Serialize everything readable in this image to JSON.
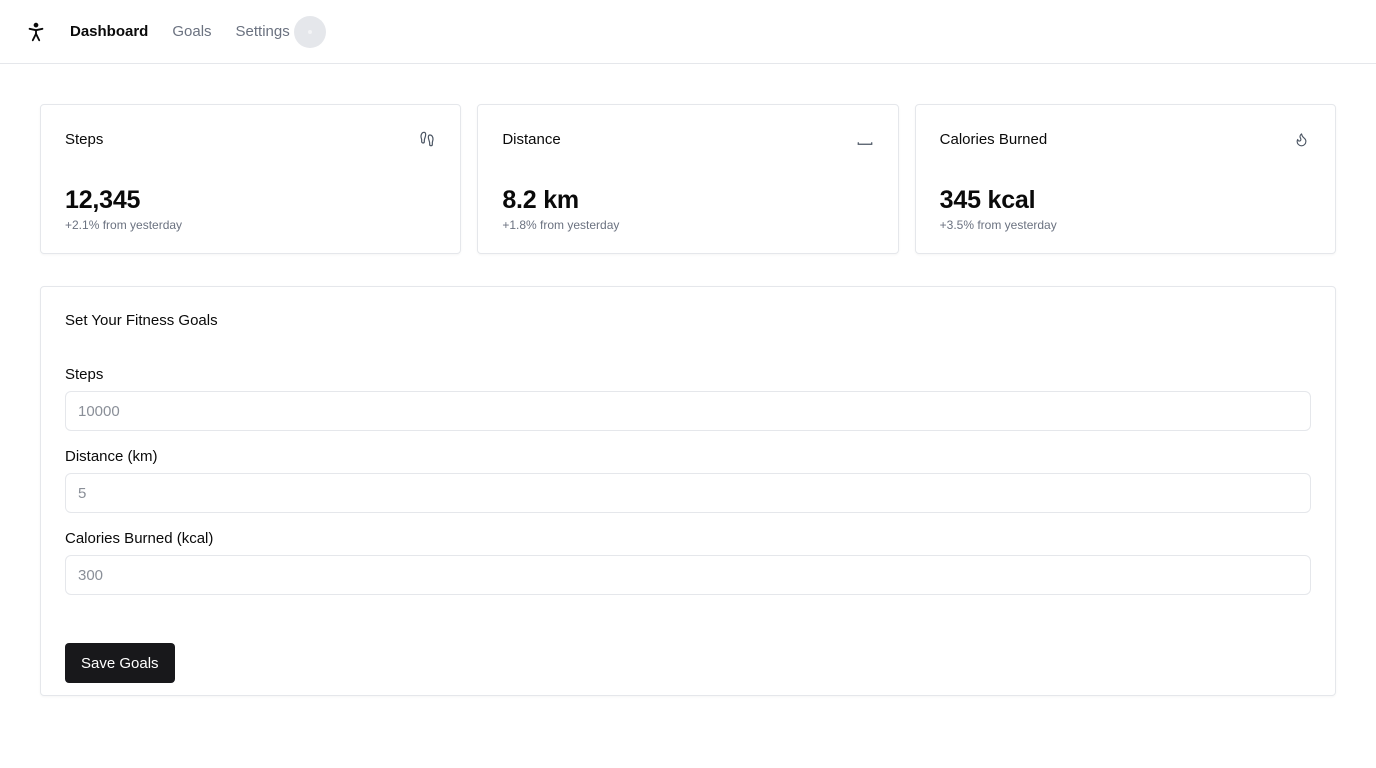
{
  "nav": {
    "logo_icon": "person-standing-icon",
    "items": [
      {
        "label": "Dashboard",
        "active": true
      },
      {
        "label": "Goals",
        "active": false
      },
      {
        "label": "Settings",
        "active": false
      }
    ]
  },
  "stats": [
    {
      "title": "Steps",
      "icon": "footprints-icon",
      "value": "12,345",
      "change": "+2.1% from yesterday"
    },
    {
      "title": "Distance",
      "icon": "ruler-icon",
      "value": "8.2 km",
      "change": "+1.8% from yesterday"
    },
    {
      "title": "Calories Burned",
      "icon": "flame-icon",
      "value": "345 kcal",
      "change": "+3.5% from yesterday"
    }
  ],
  "goals": {
    "title": "Set Your Fitness Goals",
    "fields": [
      {
        "label": "Steps",
        "placeholder": "10000"
      },
      {
        "label": "Distance (km)",
        "placeholder": "5"
      },
      {
        "label": "Calories Burned (kcal)",
        "placeholder": "300"
      }
    ],
    "save_label": "Save Goals"
  },
  "colors": {
    "primary_button": "#18181b",
    "border": "#e5e7eb",
    "muted_text": "#6b7280"
  }
}
